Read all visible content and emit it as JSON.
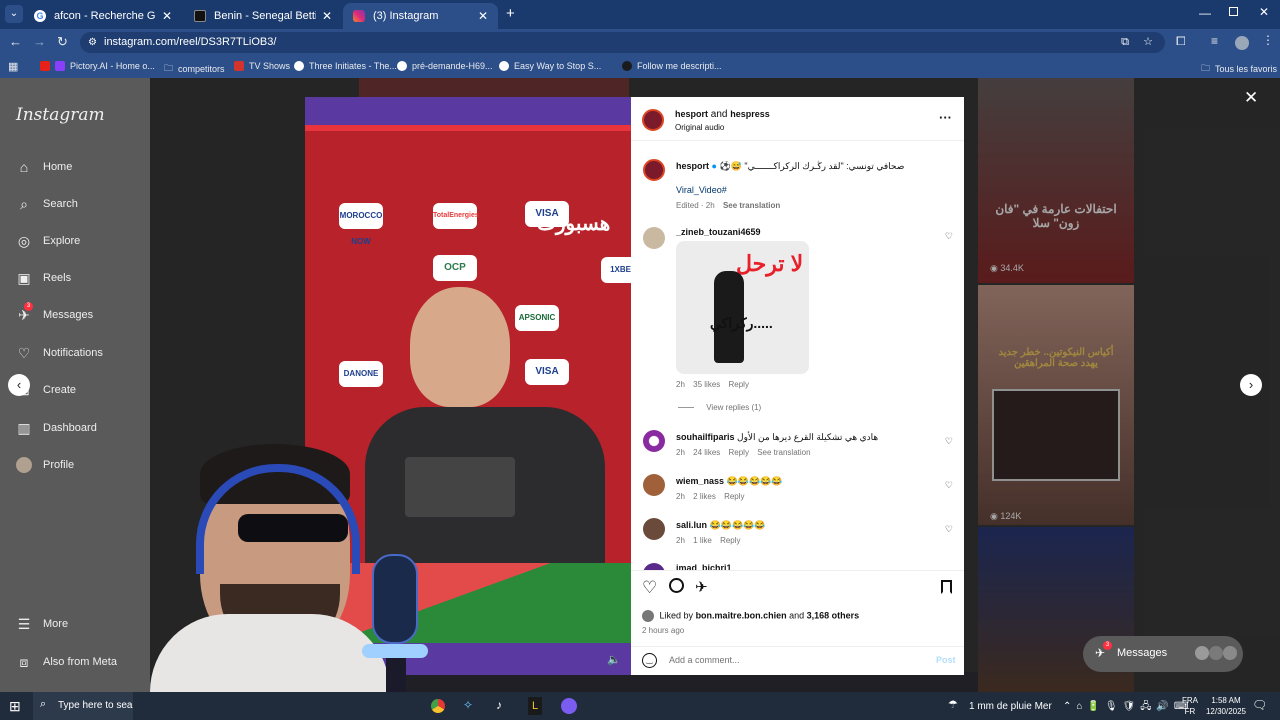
{
  "browser": {
    "tabs": [
      {
        "title": "afcon - Recherche Google",
        "color": "#4285f4"
      },
      {
        "title": "Benin - Senegal Betting - 30.12",
        "color": "#111111"
      },
      {
        "title": "(3) Instagram",
        "color": "#e1306c"
      }
    ],
    "url": "instagram.com/reel/DS3R7TLiOB3/",
    "bookmarks": [
      "Pictory.AI - Home o...",
      "competitors",
      "TV Shows",
      "Three Initiates - The...",
      "pré-demande-H69...",
      "Easy Way to Stop S...",
      "Follow me descripti..."
    ],
    "all_bookmarks": "Tous les favoris"
  },
  "sidebar": {
    "logo": "Instagram",
    "items": [
      {
        "label": "Home",
        "icon": "home-icon"
      },
      {
        "label": "Search",
        "icon": "search-icon"
      },
      {
        "label": "Explore",
        "icon": "explore-icon"
      },
      {
        "label": "Reels",
        "icon": "reels-icon"
      },
      {
        "label": "Messages",
        "icon": "messages-icon",
        "badge": "3"
      },
      {
        "label": "Notifications",
        "icon": "heart-icon"
      },
      {
        "label": "Create",
        "icon": "plus-icon"
      },
      {
        "label": "Dashboard",
        "icon": "dashboard-icon"
      },
      {
        "label": "Profile",
        "icon": "avatar"
      },
      {
        "label": "More",
        "icon": "menu-icon"
      },
      {
        "label": "Also from Meta",
        "icon": "meta-icon"
      }
    ]
  },
  "grid": {
    "thumb1_text": "احتفالات عارمة في \"فان زون\" سلا",
    "thumb1_views": "34.4K",
    "thumb2_text": "أكياس النيكوتين.. خطر جديد يهدد صحة المراهقين",
    "thumb2_views": "124K"
  },
  "video": {
    "watermark": "هسبورت",
    "sponsors": [
      "MOROCCO NOW",
      "TotalEnergies",
      "VISA",
      "OCP",
      "APSONIC",
      "DANONE",
      "1XBET",
      "VISA"
    ]
  },
  "post": {
    "header_author": "hesport",
    "header_and": "and",
    "header_coauthor": "hespress",
    "audio": "Original audio",
    "caption_user": "hesport",
    "caption_text": "⚽😅 \"صحافي تونسي: \"لقد رڭـرك الركراكـــــــي",
    "hashtag": "Viral_Video#",
    "edited": "Edited · 2h",
    "see_translation": "See translation",
    "comments": [
      {
        "user": "_zineb_touzani4659",
        "text": "",
        "image_text": "لا ترحل",
        "image_text2": "ركراكي.....",
        "time": "2h",
        "likes": "35 likes",
        "reply": "Reply",
        "view_replies": "View replies (1)"
      },
      {
        "user": "souhailfiparis",
        "text": "هادي هي تشكيلة القرع ديرها من الأول",
        "time": "2h",
        "likes": "24 likes",
        "reply": "Reply",
        "see_translation": "See translation"
      },
      {
        "user": "wiem_nass",
        "text": "😂😂😂😂😂",
        "time": "2h",
        "likes": "2 likes",
        "reply": "Reply"
      },
      {
        "user": "sali.lun",
        "text": "😂😂😂😂😂",
        "time": "2h",
        "likes": "1 like",
        "reply": "Reply"
      },
      {
        "user": "imad_bichri1",
        "text": ""
      }
    ],
    "liked_by_prefix": "Liked by",
    "liked_by_user": "bon.maitre.bon.chien",
    "liked_by_and": "and",
    "liked_by_others": "3,168 others",
    "time_ago": "2 hours ago",
    "comment_placeholder": "Add a comment...",
    "post_button": "Post"
  },
  "messages_pill": {
    "label": "Messages",
    "badge": "3"
  },
  "taskbar": {
    "search_placeholder": "Type here to search",
    "weather": "1 mm de pluie Mer",
    "lang_top": "FRA",
    "lang_bottom": "FR",
    "time": "1:58 AM",
    "date": "12/30/2025"
  }
}
